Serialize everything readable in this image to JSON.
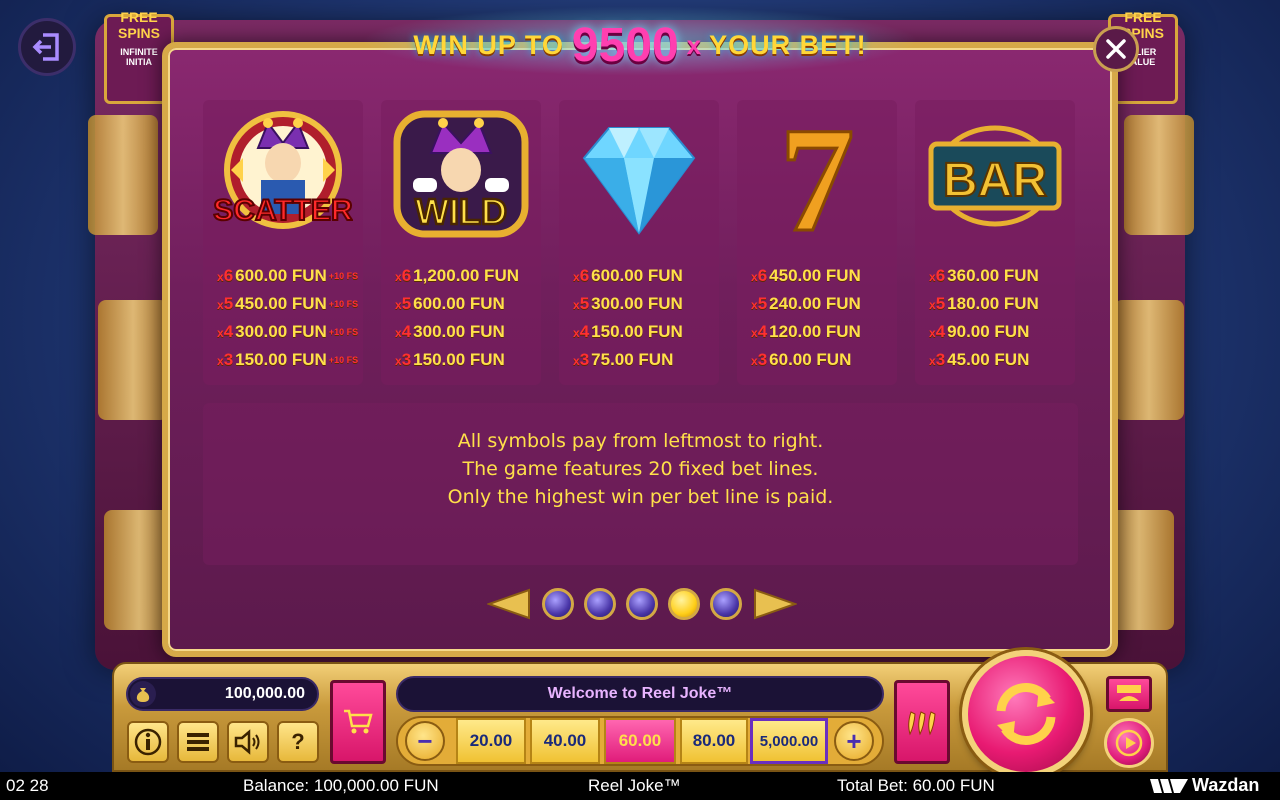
{
  "header": {
    "headline_pre": "WIN UP TO",
    "headline_value": "9500",
    "headline_x": "x",
    "headline_post": "YOUR BET!"
  },
  "background": {
    "left_banner_title": "FREE SPINS",
    "left_banner_text_1": "INFINITE",
    "left_banner_text_2": "INITIA",
    "right_banner_title": "FREE SPINS",
    "right_banner_text_1": "PLIER",
    "right_banner_text_2": "ALUE"
  },
  "symbols": [
    {
      "name": "scatter",
      "icon": "scatter-jester-icon",
      "icon_text": "SCATTER",
      "pays": [
        {
          "mult_x": "x",
          "mult_n": "6",
          "amount": "600.00 FUN",
          "bonus": "+10 FS"
        },
        {
          "mult_x": "x",
          "mult_n": "5",
          "amount": "450.00 FUN",
          "bonus": "+10 FS"
        },
        {
          "mult_x": "x",
          "mult_n": "4",
          "amount": "300.00 FUN",
          "bonus": "+10 FS"
        },
        {
          "mult_x": "x",
          "mult_n": "3",
          "amount": "150.00 FUN",
          "bonus": "+10 FS"
        }
      ]
    },
    {
      "name": "wild",
      "icon": "wild-jester-icon",
      "icon_text": "WILD",
      "pays": [
        {
          "mult_x": "x",
          "mult_n": "6",
          "amount": "1,200.00 FUN"
        },
        {
          "mult_x": "x",
          "mult_n": "5",
          "amount": "600.00 FUN"
        },
        {
          "mult_x": "x",
          "mult_n": "4",
          "amount": "300.00 FUN"
        },
        {
          "mult_x": "x",
          "mult_n": "3",
          "amount": "150.00 FUN"
        }
      ]
    },
    {
      "name": "diamond",
      "icon": "diamond-icon",
      "pays": [
        {
          "mult_x": "x",
          "mult_n": "6",
          "amount": "600.00 FUN"
        },
        {
          "mult_x": "x",
          "mult_n": "5",
          "amount": "300.00 FUN"
        },
        {
          "mult_x": "x",
          "mult_n": "4",
          "amount": "150.00 FUN"
        },
        {
          "mult_x": "x",
          "mult_n": "3",
          "amount": "75.00 FUN"
        }
      ]
    },
    {
      "name": "seven",
      "icon": "seven-icon",
      "icon_text": "7",
      "pays": [
        {
          "mult_x": "x",
          "mult_n": "6",
          "amount": "450.00 FUN"
        },
        {
          "mult_x": "x",
          "mult_n": "5",
          "amount": "240.00 FUN"
        },
        {
          "mult_x": "x",
          "mult_n": "4",
          "amount": "120.00 FUN"
        },
        {
          "mult_x": "x",
          "mult_n": "3",
          "amount": "60.00 FUN"
        }
      ]
    },
    {
      "name": "bar",
      "icon": "bar-icon",
      "icon_text": "BAR",
      "pays": [
        {
          "mult_x": "x",
          "mult_n": "6",
          "amount": "360.00 FUN"
        },
        {
          "mult_x": "x",
          "mult_n": "5",
          "amount": "180.00 FUN"
        },
        {
          "mult_x": "x",
          "mult_n": "4",
          "amount": "90.00 FUN"
        },
        {
          "mult_x": "x",
          "mult_n": "3",
          "amount": "45.00 FUN"
        }
      ]
    }
  ],
  "info": {
    "line1": "All symbols pay from leftmost to right.",
    "line2": "The game features 20 fixed bet lines.",
    "line3": "Only the highest win per bet line is paid."
  },
  "pager": {
    "total_pages": 5,
    "current_page": 4
  },
  "controls": {
    "balance": "100,000.00",
    "message": "Welcome to Reel Joke™",
    "bet_options": [
      "20.00",
      "40.00",
      "60.00",
      "80.00",
      "5,000.00"
    ],
    "selected_bet": "60.00",
    "minus": "−",
    "plus": "+",
    "info_btn": "i",
    "help_btn": "?"
  },
  "status": {
    "time": "02 28",
    "balance_label": "Balance: 100,000.00 FUN",
    "game_title": "Reel Joke™",
    "total_bet_label": "Total Bet: 60.00 FUN",
    "brand": "Wazdan"
  },
  "colors": {
    "accent_pink": "#e01c7a",
    "gold": "#d6a948",
    "pay_text": "#ffe04a",
    "multiplier": "#ff3030",
    "panel": "#701f5c"
  }
}
